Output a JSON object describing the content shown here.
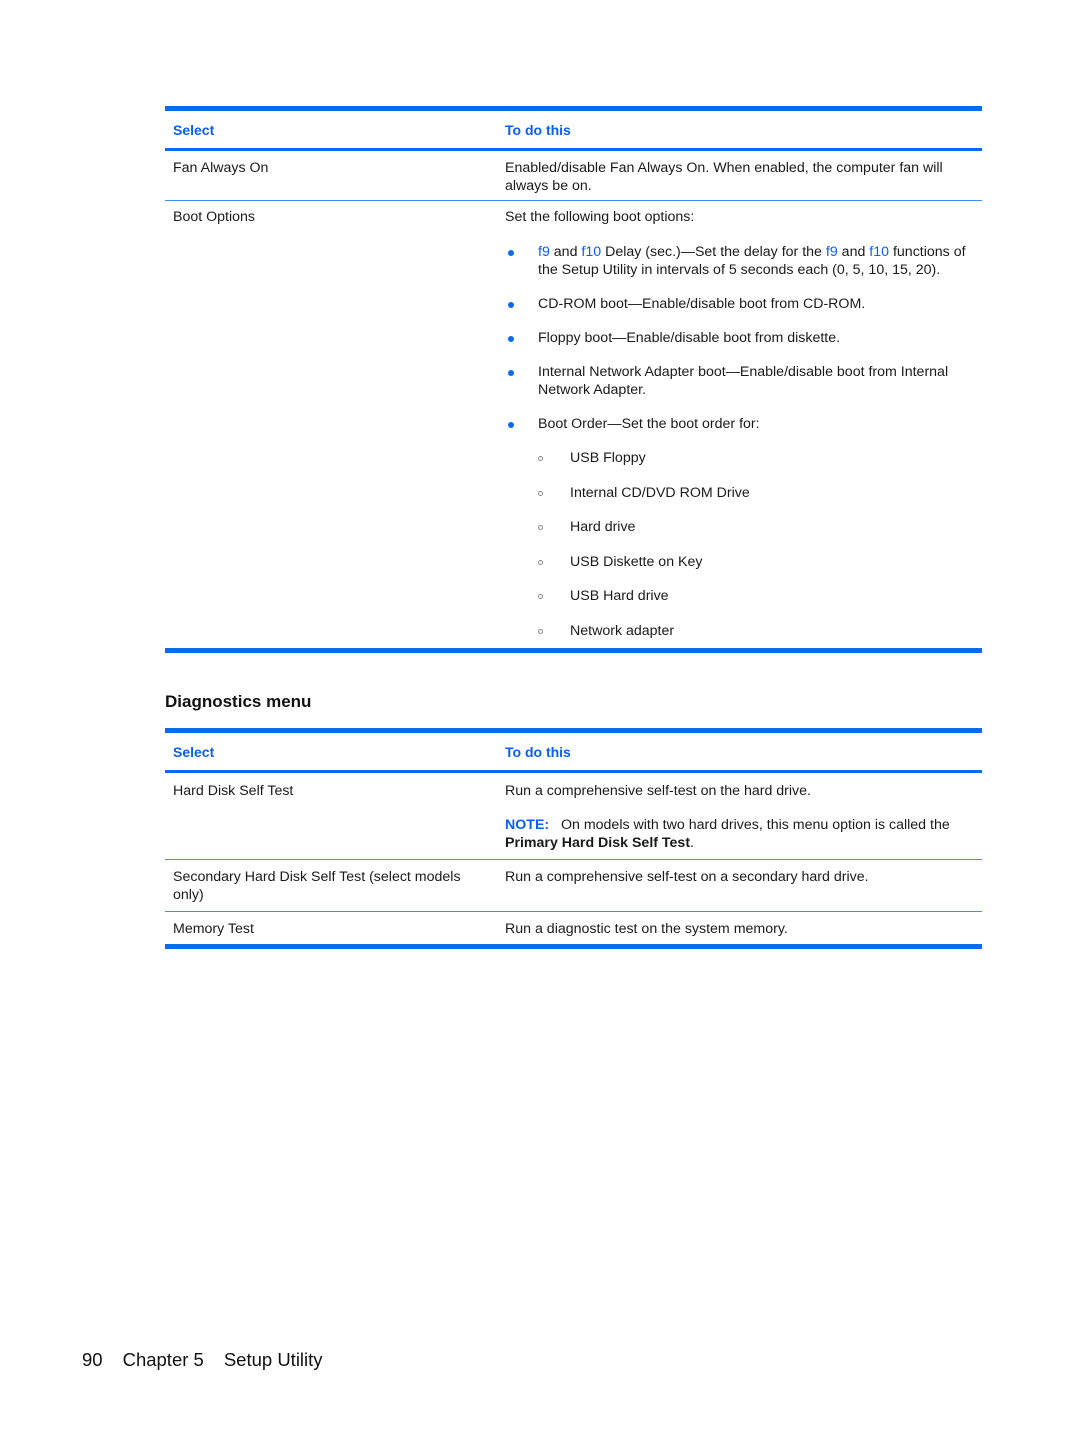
{
  "colors": {
    "accent": "#0a6af0",
    "text": "#1a1a1a"
  },
  "table1": {
    "headers": {
      "select": "Select",
      "todo": "To do this"
    },
    "rows": [
      {
        "select": "Fan Always On",
        "todo": "Enabled/disable Fan Always On. When enabled, the computer fan will always be on."
      },
      {
        "select": "Boot Options",
        "todo_intro": "Set the following boot options:",
        "bullets": [
          {
            "parts": [
              {
                "text": "f9",
                "key": true
              },
              {
                "text": " and ",
                "key": false
              },
              {
                "text": "f10",
                "key": true
              },
              {
                "text": " Delay (sec.)—Set the delay for the ",
                "key": false
              },
              {
                "text": "f9",
                "key": true
              },
              {
                "text": " and ",
                "key": false
              },
              {
                "text": "f10",
                "key": true
              },
              {
                "text": " functions of the Setup Utility in intervals of 5 seconds each (0, 5, 10, 15, 20).",
                "key": false
              }
            ]
          },
          {
            "text": "CD-ROM boot—Enable/disable boot from CD-ROM."
          },
          {
            "text": "Floppy boot—Enable/disable boot from diskette."
          },
          {
            "text": "Internal Network Adapter boot—Enable/disable boot from Internal Network Adapter."
          },
          {
            "text": "Boot Order—Set the boot order for:"
          }
        ],
        "boot_order": [
          "USB Floppy",
          "Internal CD/DVD ROM Drive",
          "Hard drive",
          "USB Diskette on Key",
          "USB Hard drive",
          "Network adapter"
        ]
      }
    ]
  },
  "section_heading": "Diagnostics menu",
  "table2": {
    "headers": {
      "select": "Select",
      "todo": "To do this"
    },
    "rows": [
      {
        "select": "Hard Disk Self Test",
        "todo": "Run a comprehensive self-test on the hard drive.",
        "note_label": "NOTE:",
        "note_text": "On models with two hard drives, this menu option is called the",
        "note_bold": "Primary Hard Disk Self Test",
        "note_end": "."
      },
      {
        "select": "Secondary Hard Disk Self Test (select models only)",
        "todo": "Run a comprehensive self-test on a secondary hard drive."
      },
      {
        "select": "Memory Test",
        "todo": "Run a diagnostic test on the system memory."
      }
    ]
  },
  "footer": {
    "page_number": "90",
    "chapter": "Chapter 5",
    "title": "Setup Utility"
  }
}
